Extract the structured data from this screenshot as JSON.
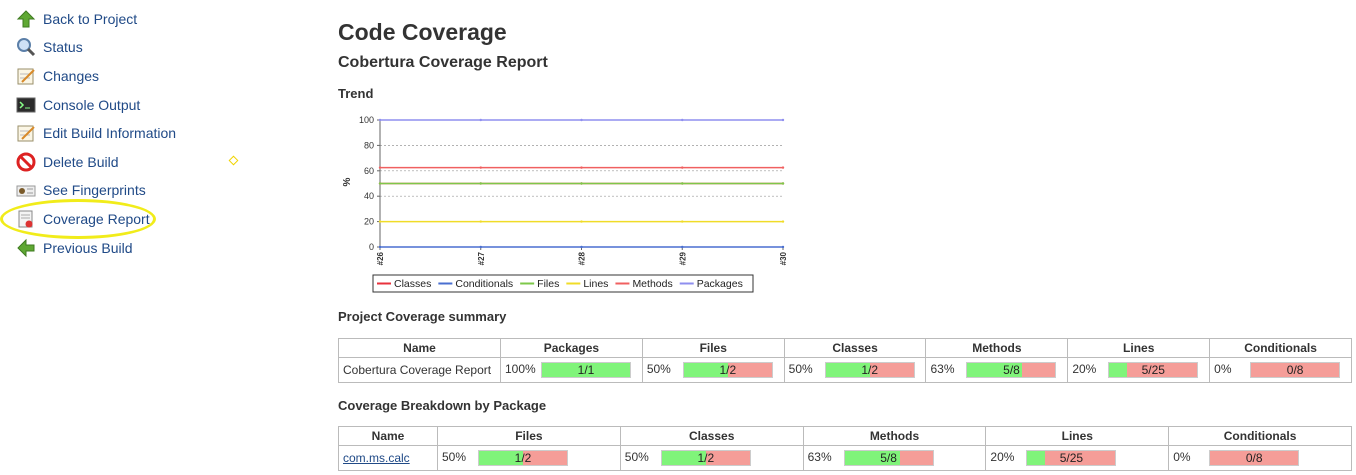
{
  "sidebar": {
    "items": [
      {
        "label": "Back to Project",
        "icon": "up-arrow-icon"
      },
      {
        "label": "Status",
        "icon": "magnifier-icon"
      },
      {
        "label": "Changes",
        "icon": "notepad-icon"
      },
      {
        "label": "Console Output",
        "icon": "terminal-icon"
      },
      {
        "label": "Edit Build Information",
        "icon": "notepad-icon"
      },
      {
        "label": "Delete Build",
        "icon": "no-entry-icon"
      },
      {
        "label": "See Fingerprints",
        "icon": "fingerprint-icon"
      },
      {
        "label": "Coverage Report",
        "icon": "report-icon"
      },
      {
        "label": "Previous Build",
        "icon": "left-arrow-icon"
      }
    ]
  },
  "page": {
    "title": "Code Coverage",
    "subtitle": "Cobertura Coverage Report",
    "trend_heading": "Trend",
    "summary_heading": "Project Coverage summary",
    "breakdown_heading": "Coverage Breakdown by Package"
  },
  "chart_data": {
    "type": "line",
    "x": [
      "#26",
      "#27",
      "#28",
      "#29",
      "#30"
    ],
    "ylabel": "%",
    "ylim": [
      0,
      100
    ],
    "yticks": [
      0,
      20,
      40,
      60,
      80,
      100
    ],
    "grid": true,
    "legend_position": "bottom",
    "series": [
      {
        "name": "Classes",
        "color": "#e8323c",
        "values": [
          50,
          50,
          50,
          50,
          50
        ]
      },
      {
        "name": "Conditionals",
        "color": "#4a6fd0",
        "values": [
          0,
          0,
          0,
          0,
          0
        ]
      },
      {
        "name": "Files",
        "color": "#7ec84a",
        "values": [
          50,
          50,
          50,
          50,
          50
        ]
      },
      {
        "name": "Lines",
        "color": "#f0dc28",
        "values": [
          20,
          20,
          20,
          20,
          20
        ]
      },
      {
        "name": "Methods",
        "color": "#f06060",
        "values": [
          62.5,
          62.5,
          62.5,
          62.5,
          62.5
        ]
      },
      {
        "name": "Packages",
        "color": "#8f8fef",
        "values": [
          100,
          100,
          100,
          100,
          100
        ]
      }
    ]
  },
  "summary": {
    "headers": [
      "Name",
      "Packages",
      "Files",
      "Classes",
      "Methods",
      "Lines",
      "Conditionals"
    ],
    "row": {
      "name": "Cobertura Coverage Report",
      "cells": [
        {
          "pct": "100%",
          "ratio": "1/1",
          "fill": 1.0
        },
        {
          "pct": "50%",
          "ratio": "1/2",
          "fill": 0.5
        },
        {
          "pct": "50%",
          "ratio": "1/2",
          "fill": 0.5
        },
        {
          "pct": "63%",
          "ratio": "5/8",
          "fill": 0.625
        },
        {
          "pct": "20%",
          "ratio": "5/25",
          "fill": 0.2
        },
        {
          "pct": "0%",
          "ratio": "0/8",
          "fill": 0.0
        }
      ]
    }
  },
  "breakdown": {
    "headers": [
      "Name",
      "Files",
      "Classes",
      "Methods",
      "Lines",
      "Conditionals"
    ],
    "row": {
      "name": "com.ms.calc",
      "cells": [
        {
          "pct": "50%",
          "ratio": "1/2",
          "fill": 0.5
        },
        {
          "pct": "50%",
          "ratio": "1/2",
          "fill": 0.5
        },
        {
          "pct": "63%",
          "ratio": "5/8",
          "fill": 0.625
        },
        {
          "pct": "20%",
          "ratio": "5/25",
          "fill": 0.2
        },
        {
          "pct": "0%",
          "ratio": "0/8",
          "fill": 0.0
        }
      ]
    }
  }
}
